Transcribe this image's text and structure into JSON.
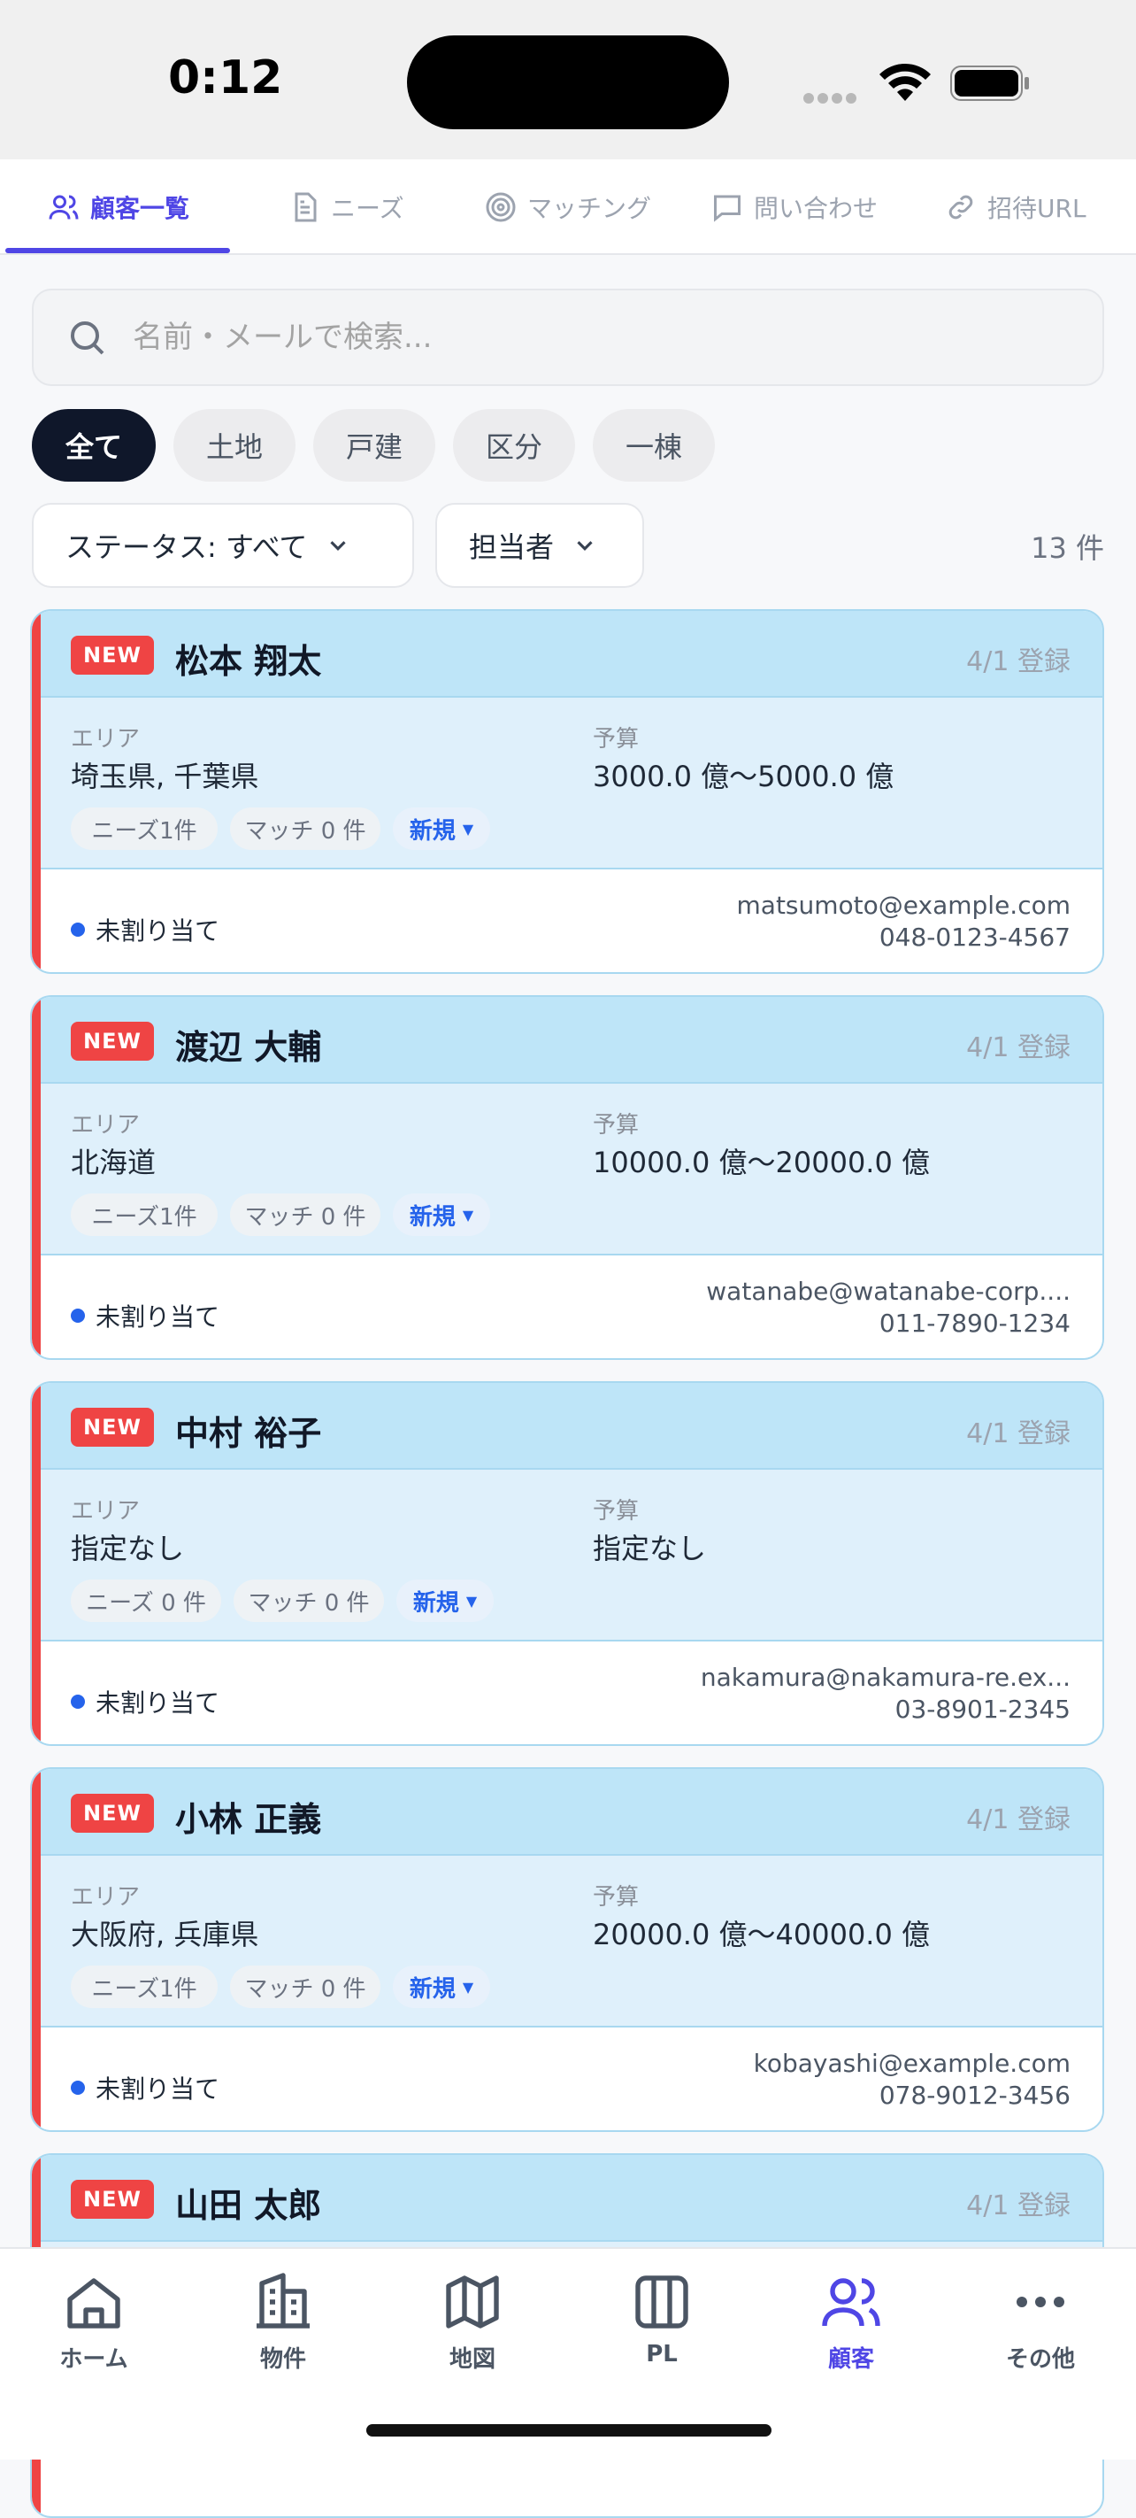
{
  "status": {
    "time": "0:12"
  },
  "tabs": [
    {
      "label": "顧客一覧",
      "icon": "users-icon",
      "active": true
    },
    {
      "label": "ニーズ",
      "icon": "document-icon"
    },
    {
      "label": "マッチング",
      "icon": "target-icon"
    },
    {
      "label": "問い合わせ",
      "icon": "chat-icon"
    },
    {
      "label": "招待URL",
      "icon": "link-icon"
    }
  ],
  "search": {
    "placeholder": "名前・メールで検索..."
  },
  "filters": [
    "全て",
    "土地",
    "戸建",
    "区分",
    "一棟"
  ],
  "dropdowns": {
    "status": "ステータス: すべて",
    "owner": "担当者"
  },
  "count": "13 件",
  "labels": {
    "new": "NEW",
    "area": "エリア",
    "budget": "予算"
  },
  "customers": [
    {
      "name": "松本 翔太",
      "date": "4/1 登録",
      "area": "埼玉県, 千葉県",
      "budget": "3000.0 億〜5000.0 億",
      "needs": "ニーズ1件",
      "matches": "マッチ 0 件",
      "status": "新規",
      "assign": "未割り当て",
      "email": "matsumoto@example.com",
      "phone": "048-0123-4567"
    },
    {
      "name": "渡辺 大輔",
      "date": "4/1 登録",
      "area": "北海道",
      "budget": "10000.0 億〜20000.0 億",
      "needs": "ニーズ1件",
      "matches": "マッチ 0 件",
      "status": "新規",
      "assign": "未割り当て",
      "email": "watanabe@watanabe-corp....",
      "phone": "011-7890-1234"
    },
    {
      "name": "中村 裕子",
      "date": "4/1 登録",
      "area": "指定なし",
      "budget": "指定なし",
      "needs": "ニーズ 0 件",
      "matches": "マッチ 0 件",
      "status": "新規",
      "assign": "未割り当て",
      "email": "nakamura@nakamura-re.ex...",
      "phone": "03-8901-2345"
    },
    {
      "name": "小林 正義",
      "date": "4/1 登録",
      "area": "大阪府, 兵庫県",
      "budget": "20000.0 億〜40000.0 億",
      "needs": "ニーズ1件",
      "matches": "マッチ 0 件",
      "status": "新規",
      "assign": "未割り当て",
      "email": "kobayashi@example.com",
      "phone": "078-9012-3456"
    },
    {
      "name": "山田 太郎",
      "date": "4/1 登録"
    }
  ],
  "nav": [
    {
      "label": "ホーム",
      "icon": "home-icon"
    },
    {
      "label": "物件",
      "icon": "building-icon"
    },
    {
      "label": "地図",
      "icon": "map-icon"
    },
    {
      "label": "PL",
      "icon": "columns-icon"
    },
    {
      "label": "顧客",
      "icon": "users-icon",
      "active": true
    },
    {
      "label": "その他",
      "icon": "more-icon"
    }
  ],
  "colors": {
    "accent": "#4f46e5",
    "new_badge": "#ef4444",
    "card_header": "#bee5f8"
  }
}
